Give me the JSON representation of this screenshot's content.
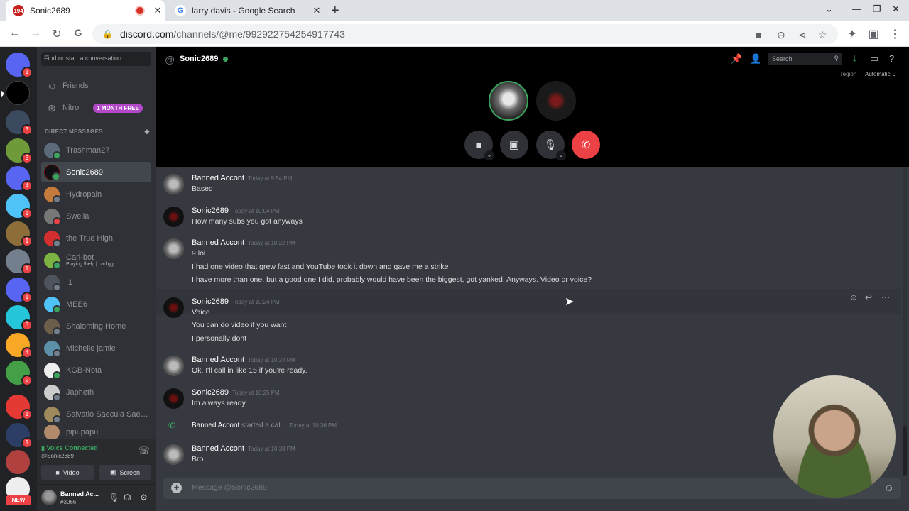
{
  "browser": {
    "tabs": [
      {
        "title": "Sonic2689",
        "favicon_badge": "194",
        "active": true
      },
      {
        "title": "larry davis - Google Search",
        "active": false
      }
    ],
    "url_host": "discord.com",
    "url_path": "/channels/@me/992922754254917743"
  },
  "dm_panel": {
    "search_placeholder": "Find or start a conversation",
    "friends_label": "Friends",
    "nitro_label": "Nitro",
    "nitro_badge": "1 MONTH FREE",
    "direct_messages_header": "DIRECT MESSAGES",
    "dms": [
      {
        "name": "Trashman27",
        "status": "online"
      },
      {
        "name": "Sonic2689",
        "status": "online",
        "active": true
      },
      {
        "name": "Hydropain",
        "status": "offline"
      },
      {
        "name": "Swella",
        "status": "dnd"
      },
      {
        "name": "the True High",
        "status": "offline"
      },
      {
        "name": "Carl-bot",
        "sub": "Playing !help | carl.gg",
        "status": "online"
      },
      {
        "name": ".1",
        "status": "offline"
      },
      {
        "name": "MEE6",
        "status": "online"
      },
      {
        "name": "Shaloming Home",
        "status": "offline"
      },
      {
        "name": "Michelle jamie",
        "status": "offline"
      },
      {
        "name": "KGB-Nota",
        "status": "online"
      },
      {
        "name": "Japheth",
        "status": "offline"
      },
      {
        "name": "Salvatio Saecula Saecu...",
        "status": "offline"
      },
      {
        "name": "pipupapu",
        "status": "offline"
      }
    ]
  },
  "voice_panel": {
    "title": "Voice Connected",
    "channel": "@Sonic2689",
    "video_label": "Video",
    "screen_label": "Screen"
  },
  "user_panel": {
    "name": "Banned Ac...",
    "tag": "#3066"
  },
  "guilds": {
    "badges": [
      "1",
      "",
      "3",
      "3",
      "4",
      "1",
      "1",
      "1",
      "1",
      "3",
      "4",
      "2",
      "1",
      "1",
      "",
      ""
    ],
    "new_label": "NEW"
  },
  "header": {
    "channel_name": "Sonic2689",
    "search_placeholder": "Search",
    "region_label": "region",
    "region_value": "Automatic"
  },
  "messages": [
    {
      "author": "Banned Accont",
      "time": "Today at 9:54 PM",
      "lines": [
        "Based"
      ]
    },
    {
      "author": "Sonic2689",
      "time": "Today at 10:04 PM",
      "lines": [
        "How many subs you got anyways"
      ]
    },
    {
      "author": "Banned Accont",
      "time": "Today at 10:22 PM",
      "lines": [
        "9 lol",
        "I had one video that grew fast and YouTube took it down and gave me a strike",
        "I have more than one, but a good one I did, probably would have been the biggest, got yanked. Anyways. Video or voice?"
      ]
    },
    {
      "author": "Sonic2689",
      "time": "Today at 10:24 PM",
      "lines": [
        "Voice",
        "You can do video if you want",
        "I personally dont"
      ]
    },
    {
      "author": "Banned Accont",
      "time": "Today at 10:24 PM",
      "lines": [
        "Ok, I'll call in like 15 if you're ready."
      ]
    },
    {
      "author": "Sonic2689",
      "time": "Today at 10:25 PM",
      "lines": [
        "Im always ready"
      ]
    },
    {
      "author": "Banned Accont",
      "time": "Today at 10:38 PM",
      "lines": [
        "Bro"
      ]
    }
  ],
  "system_message": {
    "author": "Banned Accont",
    "text": "started a call.",
    "time": "Today at 10:36 PM"
  },
  "composer": {
    "placeholder": "Message @Sonic2689"
  },
  "colors": {
    "online": "#3ba55d",
    "dnd": "#ed4245",
    "offline": "#747f8d",
    "accent": "#5865f2",
    "end_call": "#ed4245"
  }
}
